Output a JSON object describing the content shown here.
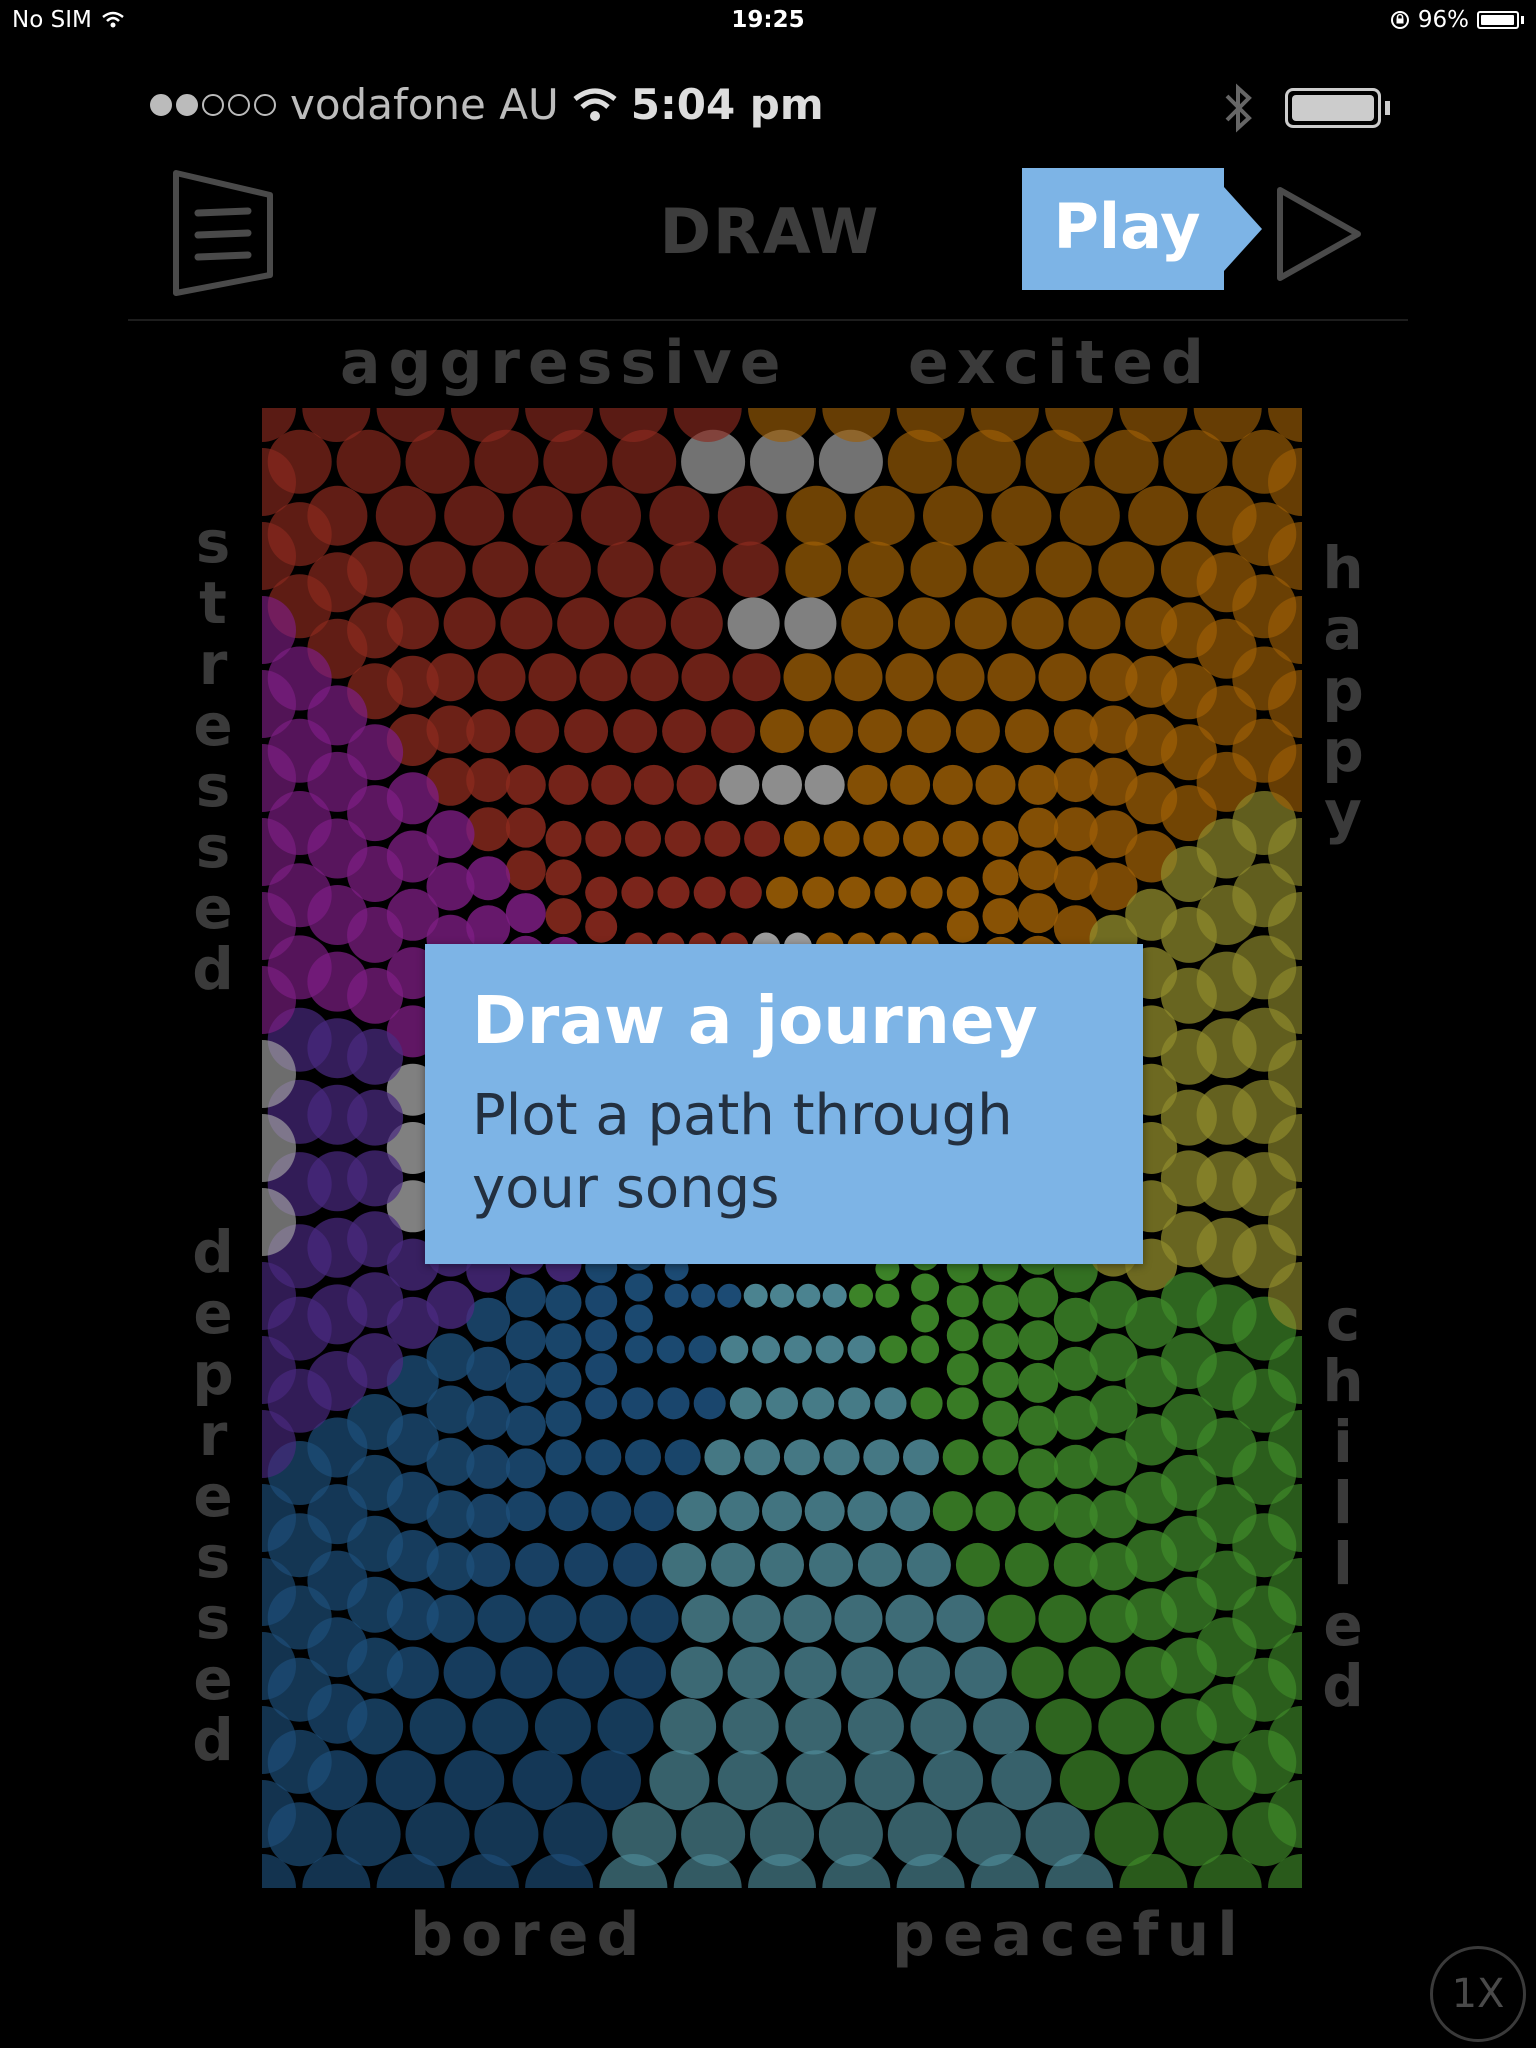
{
  "device_status": {
    "carrier": "No SIM",
    "time": "19:25",
    "battery": "96%",
    "icons": [
      "wifi-icon",
      "rotation-lock-icon",
      "battery-icon"
    ]
  },
  "app_status": {
    "carrier": "vodafone AU",
    "time": "5:04 pm",
    "signal_bars_filled": 2,
    "signal_bars_total": 5,
    "icons": [
      "wifi-icon",
      "bluetooth-icon",
      "battery-icon"
    ]
  },
  "header": {
    "title": "DRAW",
    "play_label": "Play",
    "icons": [
      "menu-icon",
      "play-icon"
    ]
  },
  "moods": {
    "aggressive": "aggressive",
    "excited": "excited",
    "stressed": "stressed",
    "happy": "happy",
    "depressed": "depressed",
    "chilled": "chilled",
    "bored": "bored",
    "peaceful": "peaceful"
  },
  "tooltip": {
    "title": "Draw a journey",
    "body": "Plot a path through your songs"
  },
  "speed_button": "1X",
  "colors": {
    "aggressive": "#8a2a1e",
    "excited": "#9c5e06",
    "stressed": "#7e1e84",
    "happy": "#8f8a2c",
    "depressed": "#4a2a80",
    "chilled": "#3f8a2a",
    "bored": "#1d4f7a",
    "peaceful": "#4f8a98",
    "neutral": "#a8a8a8",
    "tooltip": "#7db4e6"
  }
}
